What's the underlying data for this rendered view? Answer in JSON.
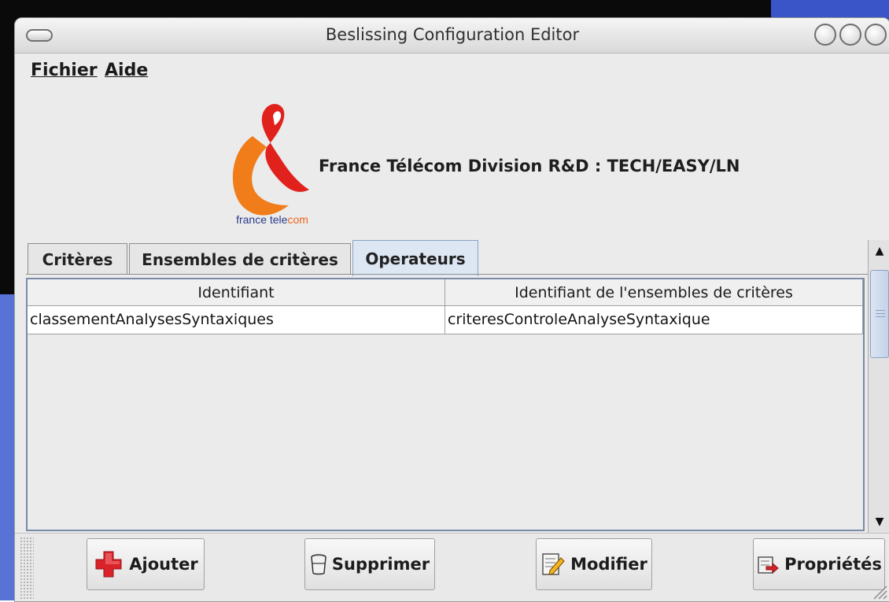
{
  "window": {
    "title": "Beslissing Configuration Editor"
  },
  "menubar": {
    "items": [
      {
        "label": "Fichier"
      },
      {
        "label": "Aide"
      }
    ]
  },
  "header": {
    "logo_text_part1": "france tele",
    "logo_text_part2": "com",
    "company": "France Télécom Division R&D : TECH/EASY/LN"
  },
  "tabs": [
    {
      "label": "Critères",
      "active": false
    },
    {
      "label": "Ensembles de critères",
      "active": false
    },
    {
      "label": "Operateurs",
      "active": true
    }
  ],
  "table": {
    "columns": [
      "Identifiant",
      "Identifiant de l'ensembles de critères"
    ],
    "rows": [
      [
        "classementAnalysesSyntaxiques",
        "criteresControleAnalyseSyntaxique"
      ]
    ]
  },
  "buttons": {
    "add": "Ajouter",
    "delete": "Supprimer",
    "edit": "Modifier",
    "properties": "Propriétés"
  },
  "colors": {
    "active_tab": "#dde6f3",
    "logo_orange": "#f07d1a",
    "logo_red": "#e0211c",
    "add_icon_red": "#d8232a"
  }
}
